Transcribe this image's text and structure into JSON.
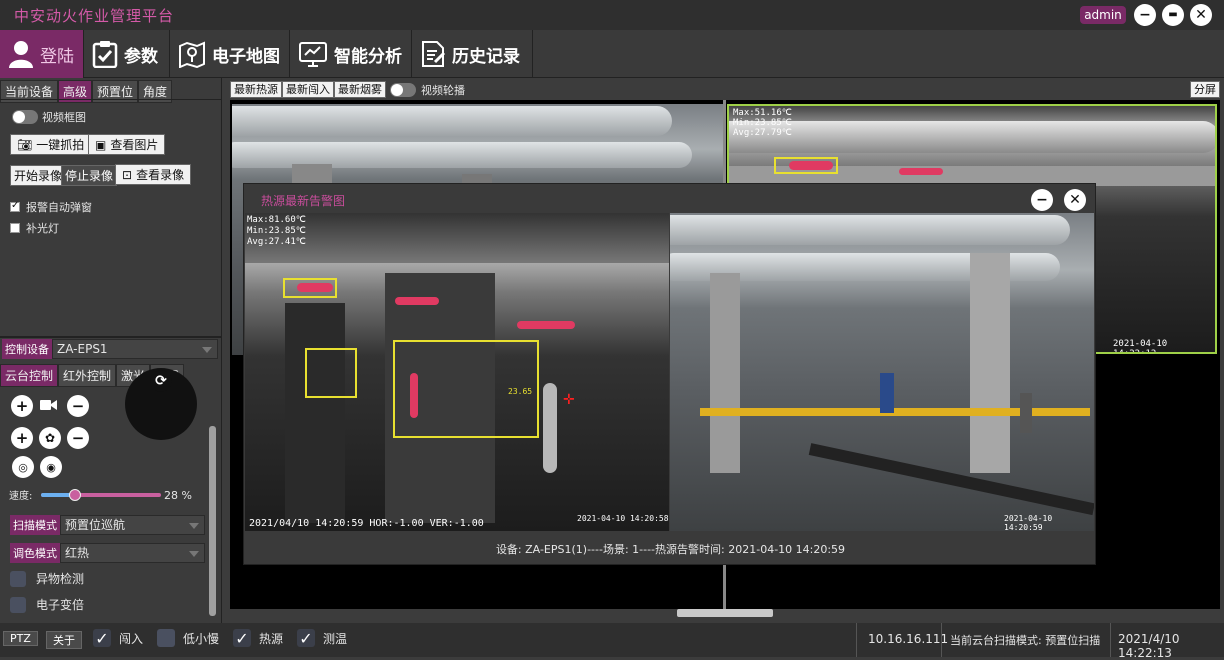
{
  "app": {
    "title": "中安动火作业管理平台",
    "user": "admin"
  },
  "window_buttons": [
    {
      "name": "minimize",
      "glyph": "−"
    },
    {
      "name": "restore",
      "glyph": "▬"
    },
    {
      "name": "close",
      "glyph": "✕"
    }
  ],
  "nav": [
    {
      "label": "登陆",
      "icon": "user-icon",
      "active": true
    },
    {
      "label": "参数",
      "icon": "clipboard-check-icon",
      "active": false
    },
    {
      "label": "电子地图",
      "icon": "map-pin-icon",
      "active": false
    },
    {
      "label": "智能分析",
      "icon": "monitor-analysis-icon",
      "active": false
    },
    {
      "label": "历史记录",
      "icon": "document-edit-icon",
      "active": false
    }
  ],
  "left": {
    "tabs": [
      "当前设备",
      "高级",
      "预置位",
      "角度"
    ],
    "active_tab": "高级",
    "video_frame_toggle": "视频框图",
    "snapshot_button": "一键抓拍",
    "view_image_button": "查看图片",
    "start_record_button": "开始录像",
    "stop_record_button": "停止录像",
    "view_record_button": "查看录像",
    "auto_popup": {
      "label": "报警自动弹窗",
      "checked": true
    },
    "fill_light": {
      "label": "补光灯",
      "checked": false
    },
    "control_device_label": "控制设备",
    "control_device_value": "ZA-EPS1",
    "control_tabs": [
      "云台控制",
      "红外控制",
      "激光",
      "透雾"
    ],
    "active_control_tab": "云台控制",
    "speed_label": "速度:",
    "speed_value": "28 %",
    "speed_fraction": 0.28,
    "scan_mode_label": "扫描模式",
    "scan_mode_value": "预置位巡航",
    "color_mode_label": "调色模式",
    "color_mode_value": "红热",
    "foreign_detect": "异物检测",
    "digital_zoom": "电子变倍"
  },
  "toolbar": {
    "buttons": [
      "最新热源",
      "最新闯入",
      "最新烟雾"
    ],
    "video_poll": "视频轮播",
    "split": "分屏"
  },
  "video": {
    "tr_stats": [
      "Max:51.16℃",
      "Min:23.85℃",
      "Avg:27.79℃"
    ],
    "tr_time": "2021-04-10 14:22:12"
  },
  "popup": {
    "title": "热源最新告警图",
    "thermal_stats": [
      "Max:81.60℃",
      "Min:23.85℃",
      "Avg:27.41℃"
    ],
    "thermal_time": "2021-04-10 14:20:58",
    "thermal_hud": "2021/04/10 14:20:59 HOR:-1.00 VER:-1.00",
    "visible_time": "2021-04-10 14:20:59",
    "temp_label": "23.65",
    "caption": "设备: ZA-EPS1(1)----场景: 1----热源告警时间: 2021-04-10 14:20:59"
  },
  "status": {
    "ptz": "PTZ",
    "off": "关于",
    "checks": [
      {
        "label": "闯入",
        "checked": true
      },
      {
        "label": "低小慢",
        "checked": false
      },
      {
        "label": "热源",
        "checked": true
      },
      {
        "label": "测温",
        "checked": true
      }
    ],
    "ip": "10.16.16.111",
    "scan_mode": "当前云台扫描模式: 预置位扫描",
    "datetime": "2021/4/10 14:22:13"
  }
}
